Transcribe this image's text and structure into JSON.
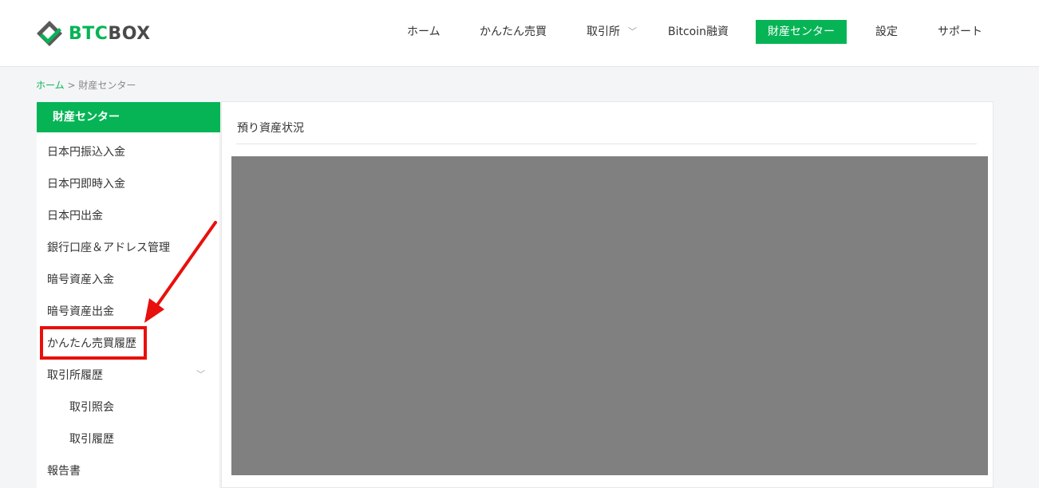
{
  "header": {
    "logo": {
      "prefix": "BTC",
      "suffix": "BOX",
      "icon": "btcbox-logo-icon"
    },
    "nav": [
      {
        "label": "ホーム"
      },
      {
        "label": "かんたん売買"
      },
      {
        "label": "取引所",
        "has_dropdown": true,
        "icon": "chevron-down-icon"
      },
      {
        "label": "Bitcoin融資"
      },
      {
        "label": "財産センター",
        "active": true
      },
      {
        "label": "設定"
      },
      {
        "label": "サポート"
      }
    ]
  },
  "breadcrumb": {
    "home": "ホーム",
    "separator": ">",
    "current": "財産センター"
  },
  "sidebar": {
    "heading": "財産センター",
    "items": [
      {
        "label": "日本円振込入金"
      },
      {
        "label": "日本円即時入金"
      },
      {
        "label": "日本円出金"
      },
      {
        "label": "銀行口座＆アドレス管理"
      },
      {
        "label": "暗号資産入金"
      },
      {
        "label": "暗号資産出金"
      },
      {
        "label": "かんたん売買履歴",
        "highlighted": true
      },
      {
        "label": "取引所履歴",
        "expanded": true,
        "icon": "chevron-down-icon"
      },
      {
        "label": "取引照会",
        "sub": true
      },
      {
        "label": "取引履歴",
        "sub": true
      },
      {
        "label": "報告書"
      }
    ]
  },
  "main": {
    "title": "預り資産状況"
  },
  "colors": {
    "brand_green": "#06b456",
    "annotation_red": "#e8100c",
    "placeholder_gray": "#808080"
  }
}
